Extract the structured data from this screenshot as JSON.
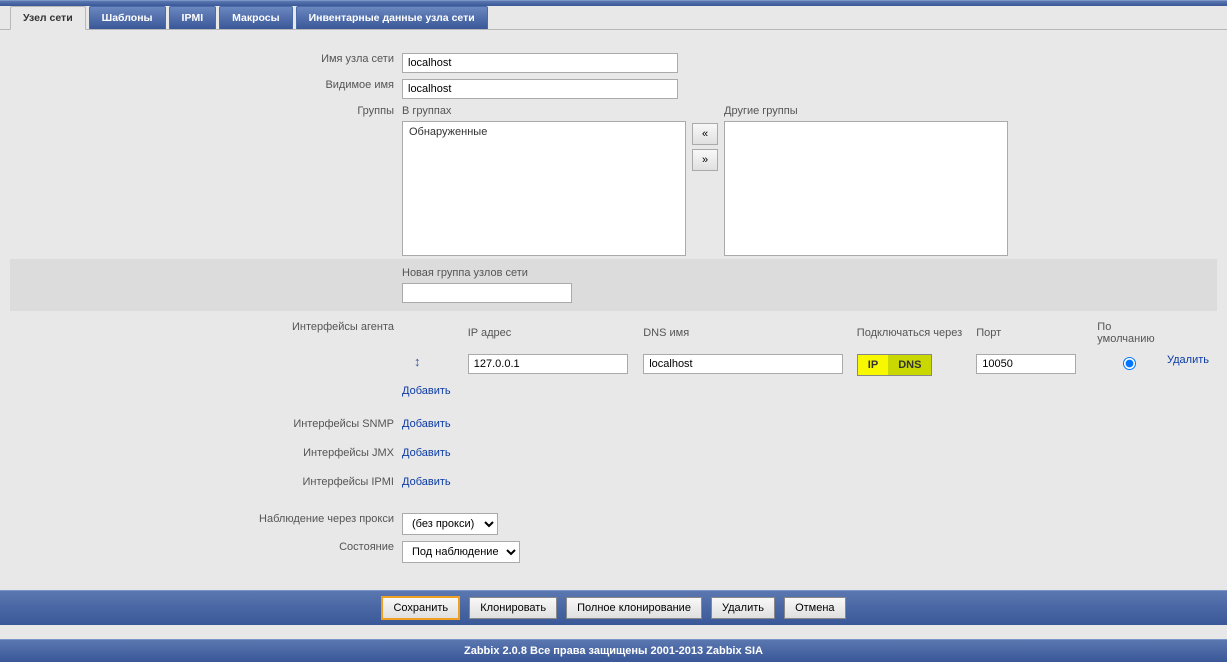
{
  "tabs": {
    "host": "Узел сети",
    "templates": "Шаблоны",
    "ipmi": "IPMI",
    "macros": "Макросы",
    "inventory": "Инвентарные данные узла сети"
  },
  "labels": {
    "hostname": "Имя узла сети",
    "visiblename": "Видимое имя",
    "groups": "Группы",
    "ingroups": "В группах",
    "othergroups": "Другие группы",
    "newgroup": "Новая группа узлов сети",
    "agent_if": "Интерфейсы агента",
    "snmp_if": "Интерфейсы SNMP",
    "jmx_if": "Интерфейсы JMX",
    "ipmi_if": "Интерфейсы IPMI",
    "proxy": "Наблюдение через прокси",
    "status": "Состояние"
  },
  "values": {
    "hostname": "localhost",
    "visiblename": "localhost",
    "ingroups_item": "Обнаруженные",
    "newgroup": ""
  },
  "iface": {
    "col_ip": "IP адрес",
    "col_dns": "DNS имя",
    "col_conn": "Подключаться через",
    "col_port": "Порт",
    "col_default": "По умолчанию",
    "drag_icon": "↕",
    "ip": "127.0.0.1",
    "dns": "localhost",
    "toggle_ip": "IP",
    "toggle_dns": "DNS",
    "port": "10050",
    "delete": "Удалить",
    "add": "Добавить"
  },
  "btns": {
    "move_left": "«",
    "move_right": "»"
  },
  "selects": {
    "proxy": "(без прокси)",
    "status": "Под наблюдением"
  },
  "actions": {
    "save": "Сохранить",
    "clone": "Клонировать",
    "fullclone": "Полное клонирование",
    "delete": "Удалить",
    "cancel": "Отмена"
  },
  "footer": "Zabbix 2.0.8 Все права защищены 2001-2013 Zabbix SIA"
}
